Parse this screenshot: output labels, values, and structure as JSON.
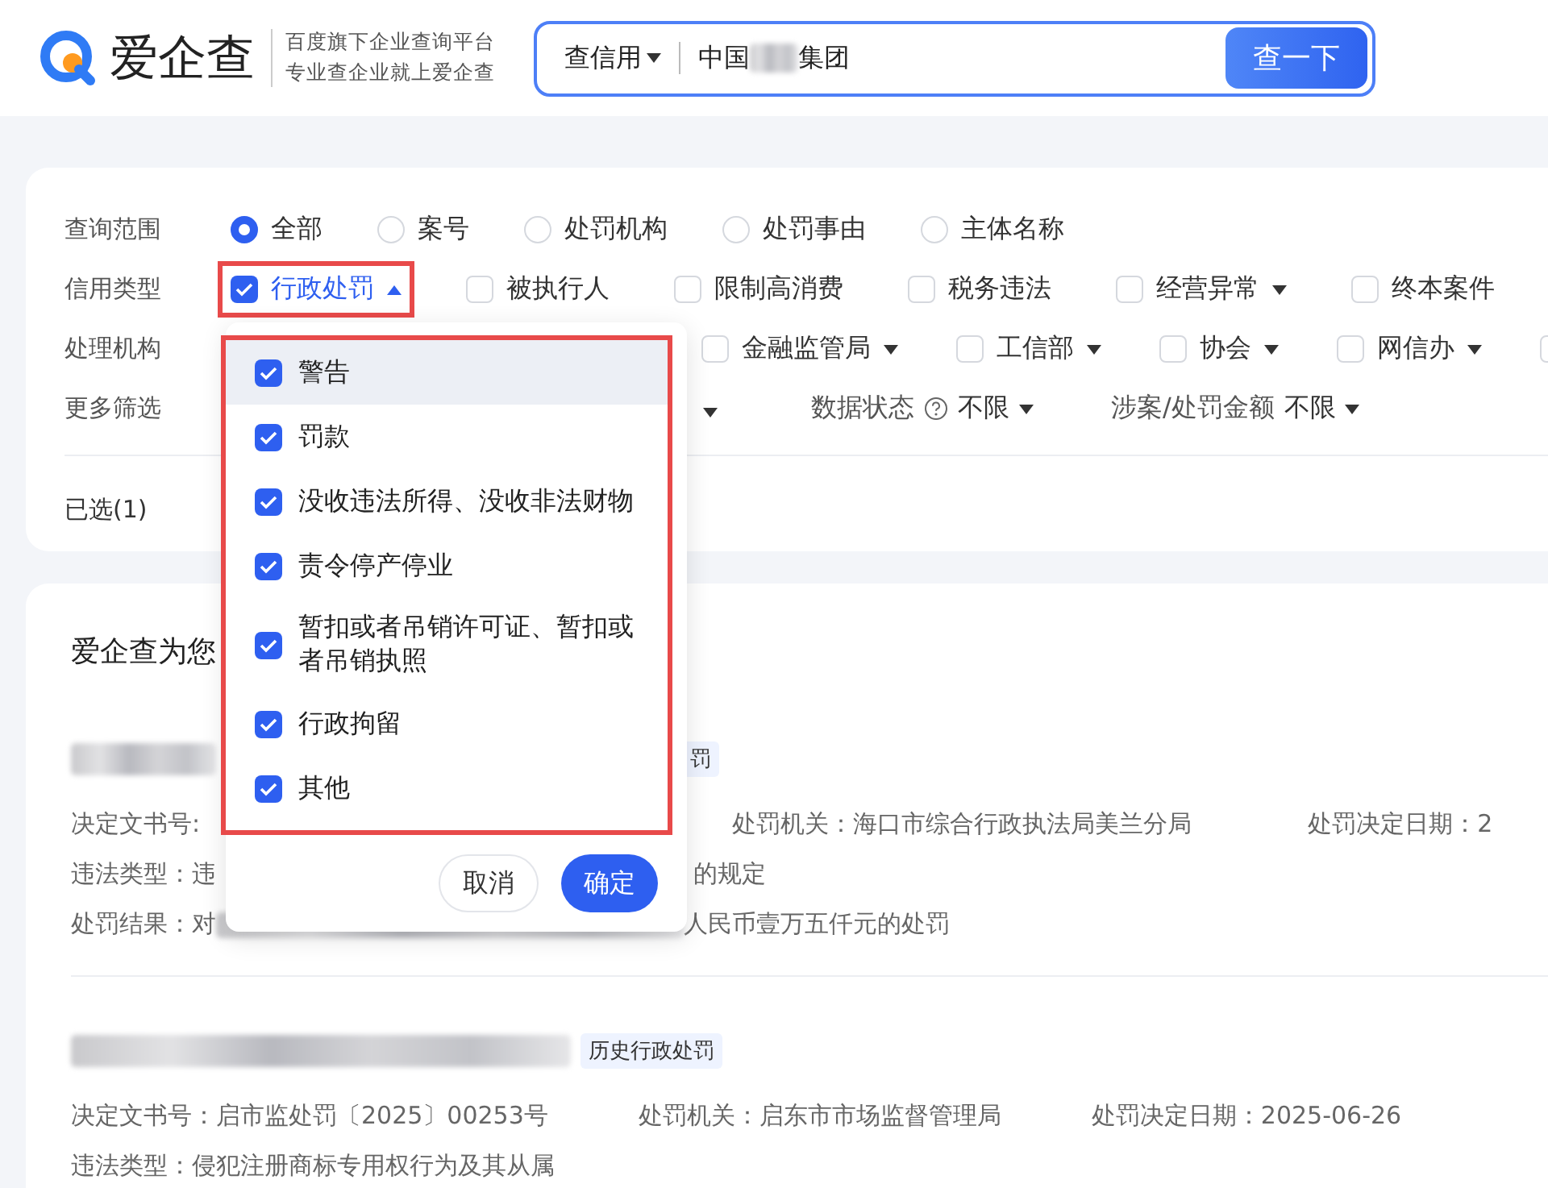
{
  "header": {
    "logo_text": "爱企查",
    "taglines": [
      "百度旗下企业查询平台",
      "专业查企业就上爱企查"
    ],
    "search": {
      "scope": "查信用",
      "value_before": "中国",
      "value_after": "集团",
      "button": "查一下"
    }
  },
  "filters": {
    "rows": [
      {
        "label": "查询范围",
        "kind": "radio",
        "options": [
          {
            "label": "全部",
            "selected": true
          },
          {
            "label": "案号",
            "selected": false
          },
          {
            "label": "处罚机构",
            "selected": false
          },
          {
            "label": "处罚事由",
            "selected": false
          },
          {
            "label": "主体名称",
            "selected": false
          }
        ]
      },
      {
        "label": "信用类型",
        "kind": "checkbox",
        "options": [
          {
            "label": "行政处罚",
            "checked": true,
            "has_menu": true,
            "expanded": true,
            "annotated": true
          },
          {
            "label": "被执行人",
            "checked": false
          },
          {
            "label": "限制高消费",
            "checked": false
          },
          {
            "label": "税务违法",
            "checked": false
          },
          {
            "label": "经营异常",
            "checked": false,
            "has_menu": true,
            "expanded": false
          },
          {
            "label": "终本案件",
            "checked": false
          }
        ]
      },
      {
        "label": "处理机构",
        "kind": "checkbox",
        "options": [
          {
            "label": "金融监管局",
            "checked": false,
            "has_menu": true,
            "expanded": false
          },
          {
            "label": "工信部",
            "checked": false,
            "has_menu": true,
            "expanded": false
          },
          {
            "label": "协会",
            "checked": false,
            "has_menu": true,
            "expanded": false
          },
          {
            "label": "网信办",
            "checked": false,
            "has_menu": true,
            "expanded": false
          },
          {
            "checked": false
          }
        ]
      },
      {
        "label": "更多筛选",
        "kind": "select",
        "options": [
          {
            "has_menu": true
          },
          {
            "label": "数据状态",
            "help": true,
            "value": "不限",
            "has_menu": true
          },
          {
            "label": "涉案/处罚金额",
            "value": "不限",
            "has_menu": true
          }
        ]
      }
    ],
    "selected_count": "已选(1)"
  },
  "dropdown": {
    "annotated": true,
    "items": [
      {
        "label": "警告",
        "checked": true,
        "highlighted": true
      },
      {
        "label": "罚款",
        "checked": true,
        "highlighted": false
      },
      {
        "label": "没收违法所得、没收非法财物",
        "checked": true,
        "highlighted": false
      },
      {
        "label": "责令停产停业",
        "checked": true,
        "highlighted": false
      },
      {
        "label": "暂扣或者吊销许可证、暂扣或者吊销执照",
        "checked": true,
        "highlighted": false
      },
      {
        "label": "行政拘留",
        "checked": true,
        "highlighted": false
      },
      {
        "label": "其他",
        "checked": true,
        "highlighted": false
      }
    ],
    "buttons": [
      {
        "label": "取消",
        "kind": "secondary"
      },
      {
        "label": "确定",
        "kind": "primary"
      }
    ]
  },
  "results": {
    "title": "爱企查为您",
    "records": [
      {
        "tag": "罚",
        "lines": [
          [
            {
              "text": "决定文书号:"
            },
            {
              "text": "处罚机关：海口市综合行政执法局美兰分局"
            },
            {
              "text": "处罚决定日期：2"
            }
          ],
          [
            {
              "text": "违法类型：违"
            },
            {
              "text": "的规定"
            }
          ],
          [
            {
              "text": "处罚结果：对",
              "redacted_after": true
            },
            {
              "text": "人民币壹万五仟元的处罚"
            }
          ]
        ]
      },
      {
        "tag": "历史行政处罚",
        "lines": [
          [
            {
              "text": "决定文书号：启市监处罚〔2025〕00253号"
            },
            {
              "text": "处罚机关：启东市市场监督管理局"
            },
            {
              "text": "处罚决定日期：2025-06-26"
            }
          ],
          [
            {
              "text": "违法类型：侵犯注册商标专用权行为及其从属"
            }
          ]
        ]
      }
    ]
  }
}
